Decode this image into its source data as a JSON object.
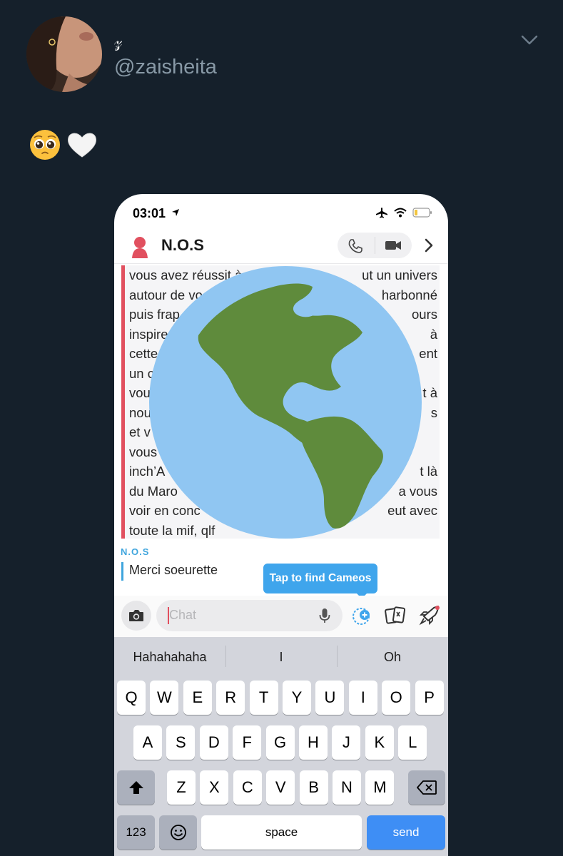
{
  "tweet": {
    "display_name": "𝓏",
    "handle": "@zaisheita",
    "emojis": [
      "pleading-face",
      "white-heart"
    ]
  },
  "screenshot": {
    "status": {
      "time": "03:01"
    },
    "chat": {
      "title": "N.O.S",
      "quoted_lines": [
        [
          "vous avez réussit à",
          "ut un univers"
        ],
        [
          "autour de vo",
          "harbonné"
        ],
        [
          "puis frap",
          "ours"
        ],
        [
          "inspire",
          "à"
        ],
        [
          "cette",
          "ent"
        ],
        [
          "un c",
          ""
        ],
        [
          "vou",
          "t à"
        ],
        [
          "nou",
          "s"
        ],
        [
          "et v",
          ""
        ],
        [
          "vous",
          ""
        ],
        [
          "inch’A",
          "t là"
        ],
        [
          "du Maro",
          "a vous"
        ],
        [
          "voir en conc",
          "eut avec"
        ],
        [
          "toute la mif, qlf",
          ""
        ]
      ],
      "reply_sender": "N.O.S",
      "reply_text": "Merci soeurette",
      "tooltip": "Tap to find Cameos",
      "input_placeholder": "Chat"
    },
    "keyboard": {
      "suggestions": [
        "Hahahahaha",
        "I",
        "Oh"
      ],
      "row1": [
        "Q",
        "W",
        "E",
        "R",
        "T",
        "Y",
        "U",
        "I",
        "O",
        "P"
      ],
      "row2": [
        "A",
        "S",
        "D",
        "F",
        "G",
        "H",
        "J",
        "K",
        "L"
      ],
      "row3": [
        "Z",
        "X",
        "C",
        "V",
        "B",
        "N",
        "M"
      ],
      "numbers_key": "123",
      "space_key": "space",
      "send_key": "send"
    },
    "colors": {
      "quote_bar": "#e1505f",
      "reply_accent": "#3fa5dd",
      "send_key": "#3e8ef5",
      "globe_ocean": "#90c6f2",
      "globe_land": "#5f8b3c"
    }
  }
}
